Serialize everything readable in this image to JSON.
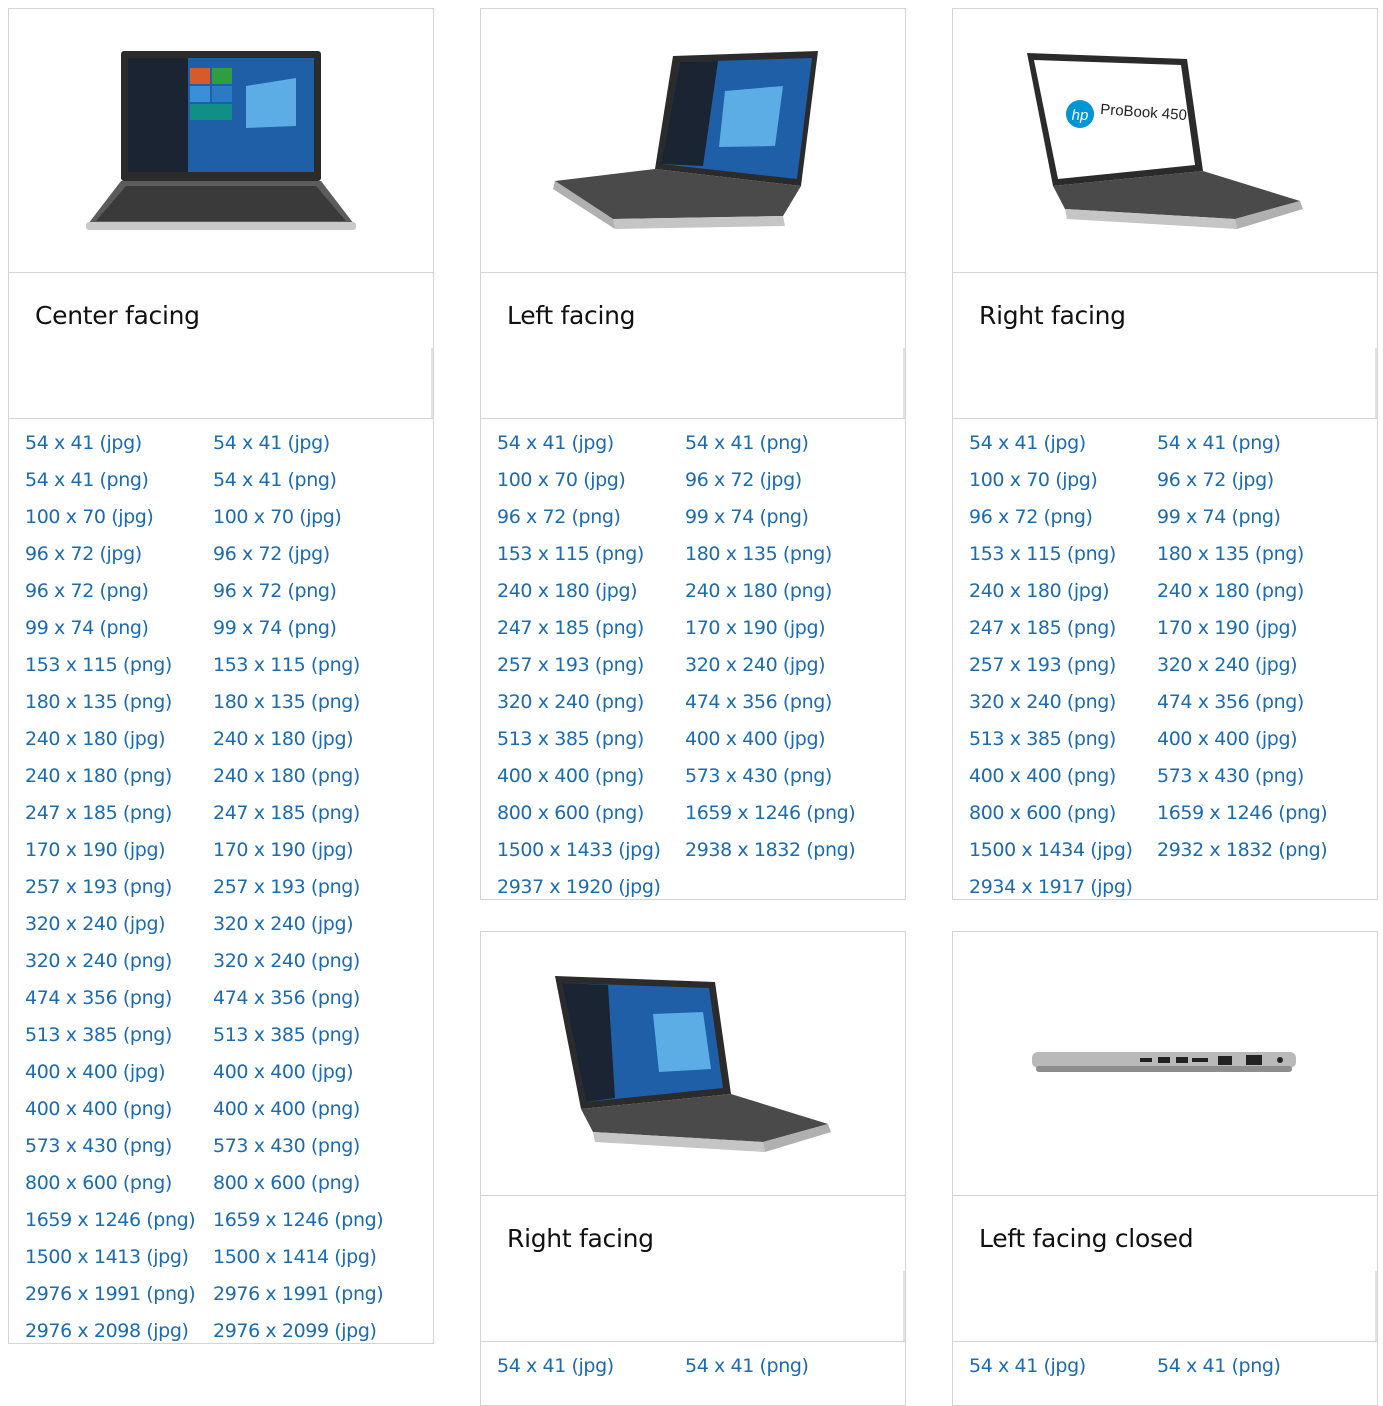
{
  "cards": [
    {
      "title": "Center facing",
      "image": "laptop-center-facing",
      "links": [
        "54 x 41 (jpg)",
        "54 x 41 (jpg)",
        "54 x 41 (png)",
        "54 x 41 (png)",
        "100 x 70 (jpg)",
        "100 x 70 (jpg)",
        "96 x 72 (jpg)",
        "96 x 72 (jpg)",
        "96 x 72 (png)",
        "96 x 72 (png)",
        "99 x 74 (png)",
        "99 x 74 (png)",
        "153 x 115 (png)",
        "153 x 115 (png)",
        "180 x 135 (png)",
        "180 x 135 (png)",
        "240 x 180 (jpg)",
        "240 x 180 (jpg)",
        "240 x 180 (png)",
        "240 x 180 (png)",
        "247 x 185 (png)",
        "247 x 185 (png)",
        "170 x 190 (jpg)",
        "170 x 190 (jpg)",
        "257 x 193 (png)",
        "257 x 193 (png)",
        "320 x 240 (jpg)",
        "320 x 240 (jpg)",
        "320 x 240 (png)",
        "320 x 240 (png)",
        "474 x 356 (png)",
        "474 x 356 (png)",
        "513 x 385 (png)",
        "513 x 385 (png)",
        "400 x 400 (jpg)",
        "400 x 400 (jpg)",
        "400 x 400 (png)",
        "400 x 400 (png)",
        "573 x 430 (png)",
        "573 x 430 (png)",
        "800 x 600 (png)",
        "800 x 600 (png)",
        "1659 x 1246 (png)",
        "1659 x 1246 (png)",
        "1500 x 1413 (jpg)",
        "1500 x 1414 (jpg)",
        "2976 x 1991 (png)",
        "2976 x 1991 (png)",
        "2976 x 2098 (jpg)",
        "2976 x 2099 (jpg)"
      ]
    },
    {
      "title": "Left facing",
      "image": "laptop-left-facing",
      "links": [
        "54 x 41 (jpg)",
        "54 x 41 (png)",
        "100 x 70 (jpg)",
        "96 x 72 (jpg)",
        "96 x 72 (png)",
        "99 x 74 (png)",
        "153 x 115 (png)",
        "180 x 135 (png)",
        "240 x 180 (jpg)",
        "240 x 180 (png)",
        "247 x 185 (png)",
        "170 x 190 (jpg)",
        "257 x 193 (png)",
        "320 x 240 (jpg)",
        "320 x 240 (png)",
        "474 x 356 (png)",
        "513 x 385 (png)",
        "400 x 400 (jpg)",
        "400 x 400 (png)",
        "573 x 430 (png)",
        "800 x 600 (png)",
        "1659 x 1246 (png)",
        "1500 x 1433 (jpg)",
        "2938 x 1832 (png)",
        "2937 x 1920 (jpg)"
      ]
    },
    {
      "title": "Right facing",
      "image": "laptop-right-facing-probook",
      "logo_text": "ProBook 450",
      "links": [
        "54 x 41 (jpg)",
        "54 x 41 (png)",
        "100 x 70 (jpg)",
        "96 x 72 (jpg)",
        "96 x 72 (png)",
        "99 x 74 (png)",
        "153 x 115 (png)",
        "180 x 135 (png)",
        "240 x 180 (jpg)",
        "240 x 180 (png)",
        "247 x 185 (png)",
        "170 x 190 (jpg)",
        "257 x 193 (png)",
        "320 x 240 (jpg)",
        "320 x 240 (png)",
        "474 x 356 (png)",
        "513 x 385 (png)",
        "400 x 400 (jpg)",
        "400 x 400 (png)",
        "573 x 430 (png)",
        "800 x 600 (png)",
        "1659 x 1246 (png)",
        "1500 x 1434 (jpg)",
        "2932 x 1832 (png)",
        "2934 x 1917 (jpg)"
      ]
    },
    {
      "title": "Right facing",
      "image": "laptop-right-facing",
      "links": [
        "54 x 41 (jpg)",
        "54 x 41 (png)"
      ]
    },
    {
      "title": "Left facing closed",
      "image": "laptop-left-facing-closed",
      "links": [
        "54 x 41 (jpg)",
        "54 x 41 (png)"
      ]
    }
  ],
  "colors": {
    "link": "#1a6bb0",
    "border": "#d4d4d4",
    "title": "#111111"
  }
}
